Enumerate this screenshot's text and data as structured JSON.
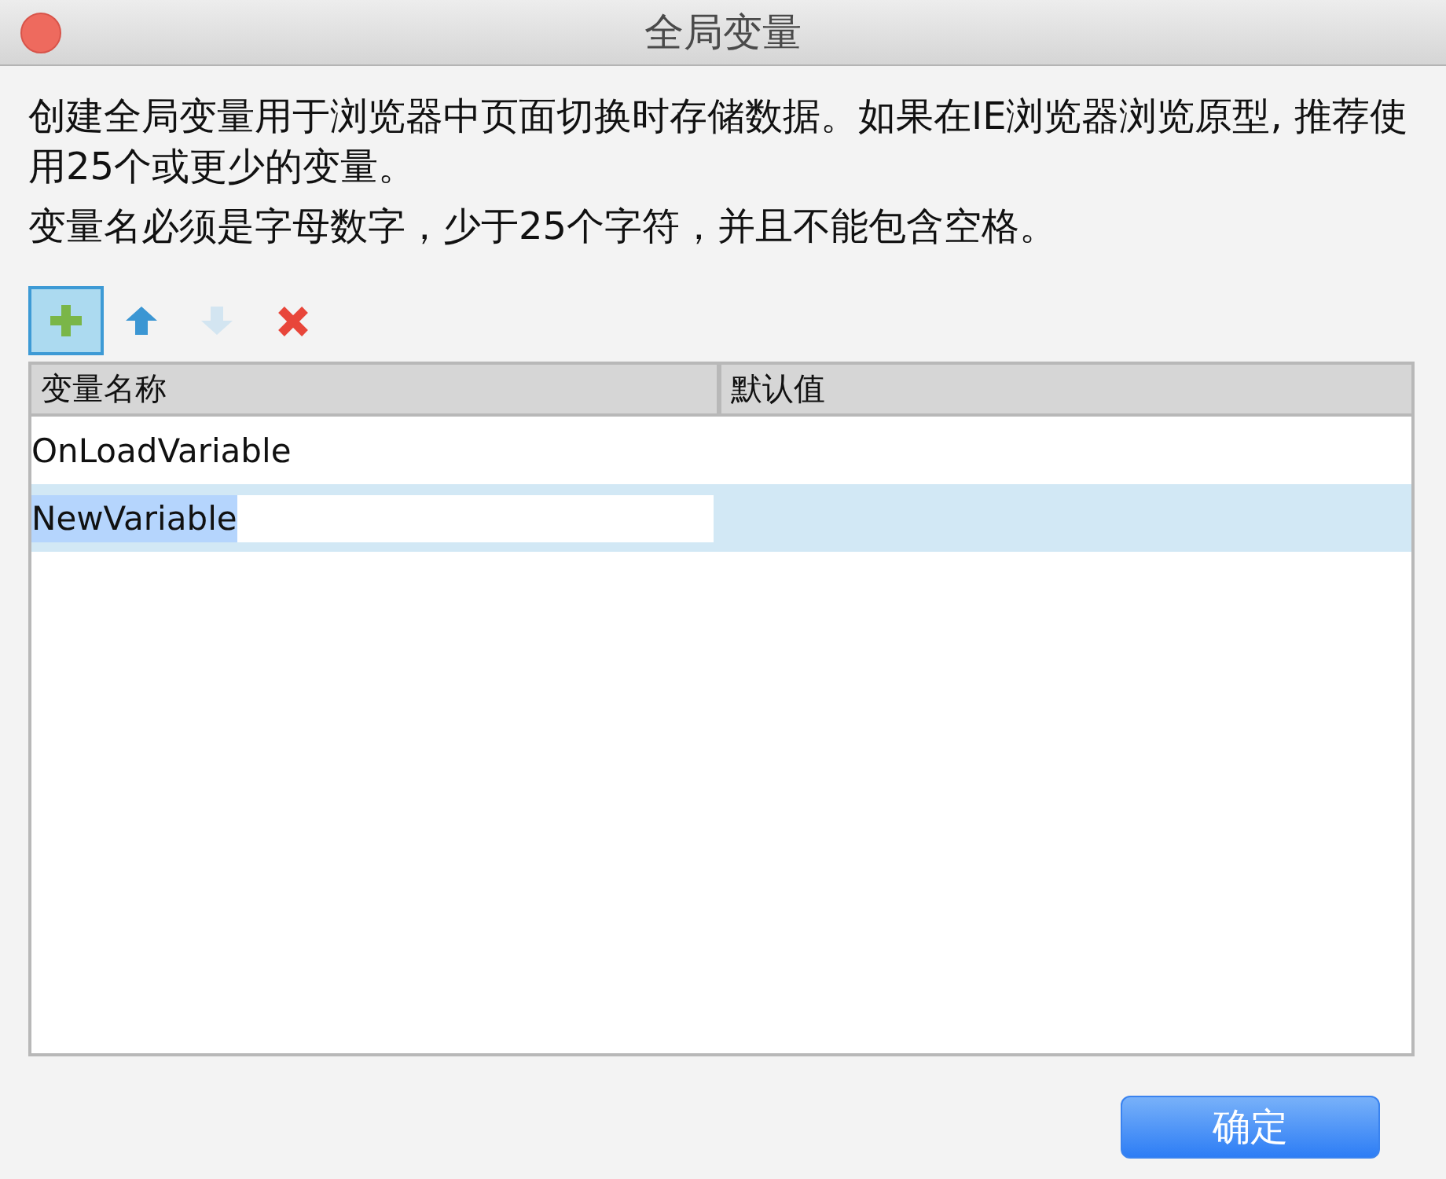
{
  "window": {
    "title": "全局变量"
  },
  "description": [
    "创建全局变量用于浏览器中页面切换时存储数据。如果在IE浏览器浏览原型, 推荐使用25个或更少的变量。",
    "变量名必须是字母数字，少于25个字符，并且不能包含空格。"
  ],
  "toolbar": [
    {
      "kind": "add",
      "selected": true,
      "disabled": false
    },
    {
      "kind": "move_up",
      "selected": false,
      "disabled": false
    },
    {
      "kind": "move_down",
      "selected": false,
      "disabled": true
    },
    {
      "kind": "delete",
      "selected": false,
      "disabled": false
    }
  ],
  "table": {
    "columns": [
      "变量名称",
      "默认值"
    ],
    "rows": [
      {
        "name": "OnLoadVariable",
        "selected": false,
        "editing": false
      },
      {
        "name": "NewVariable",
        "selected": true,
        "editing": true
      }
    ]
  },
  "buttons": [
    {
      "label": "确定",
      "kind": "primary"
    }
  ]
}
